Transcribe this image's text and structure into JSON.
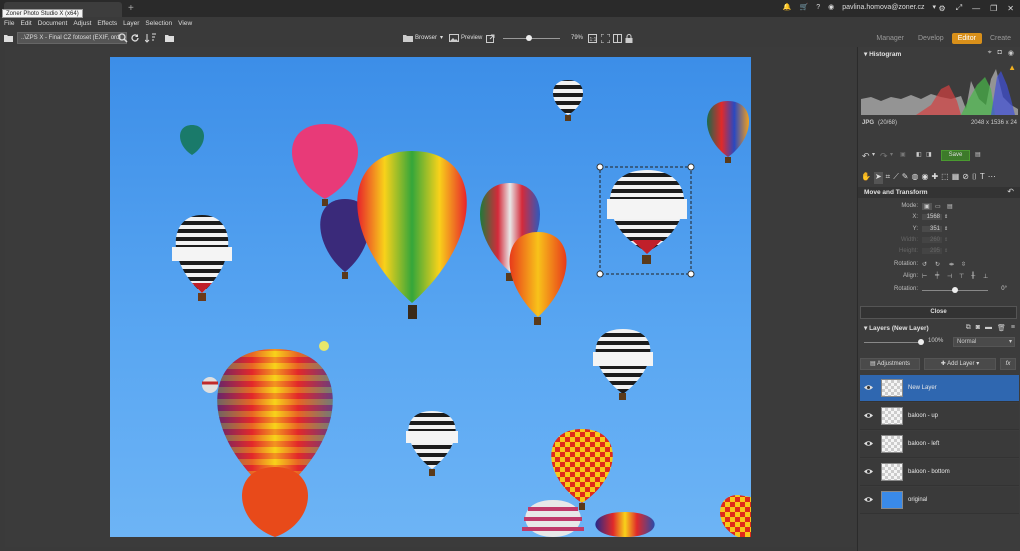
{
  "window": {
    "tab_title": "Zoner Photo Studio X (x64)",
    "user_email": "pavlina.homova@zoner.cz"
  },
  "menu": [
    "File",
    "Edit",
    "Document",
    "Adjust",
    "Effects",
    "Layer",
    "Selection",
    "View"
  ],
  "toolbar": {
    "path": "..\\ZPS X - Final CZ fotoset (EXIF, ordi",
    "browser_label": "Browser",
    "preview_label": "Preview",
    "zoom": "79%",
    "zoom_fraction": 0.45
  },
  "modes": [
    {
      "label": "Manager",
      "active": false
    },
    {
      "label": "Develop",
      "active": false
    },
    {
      "label": "Editor",
      "active": true
    },
    {
      "label": "Create",
      "active": false
    }
  ],
  "histogram": {
    "title": "Histogram",
    "format": "JPG",
    "index": "(20/68)",
    "dimensions": "2048 x 1536 x 24"
  },
  "editbar": {
    "save_label": "Save"
  },
  "transform": {
    "title": "Move and Transform",
    "mode_label": "Mode:",
    "x_label": "X:",
    "x_value": "1568",
    "y_label": "Y:",
    "y_value": "351",
    "width_label": "Width:",
    "width_value": "260",
    "height_label": "Height:",
    "height_value": "295",
    "rotation_label": "Rotation:",
    "align_label": "Align:",
    "rotation2_label": "Rotation:",
    "rotation_value": "0°",
    "close_label": "Close"
  },
  "layers": {
    "title": "Layers (New Layer)",
    "opacity": "100%",
    "blend_mode": "Normal",
    "adjustments_label": "Adjustments",
    "add_layer_label": "Add Layer",
    "fx_label": "fx",
    "items": [
      {
        "name": "New Layer",
        "selected": true
      },
      {
        "name": "baloon - up",
        "selected": false
      },
      {
        "name": "baloon - left",
        "selected": false
      },
      {
        "name": "baloon - bottom",
        "selected": false
      },
      {
        "name": "original",
        "selected": false
      }
    ]
  }
}
